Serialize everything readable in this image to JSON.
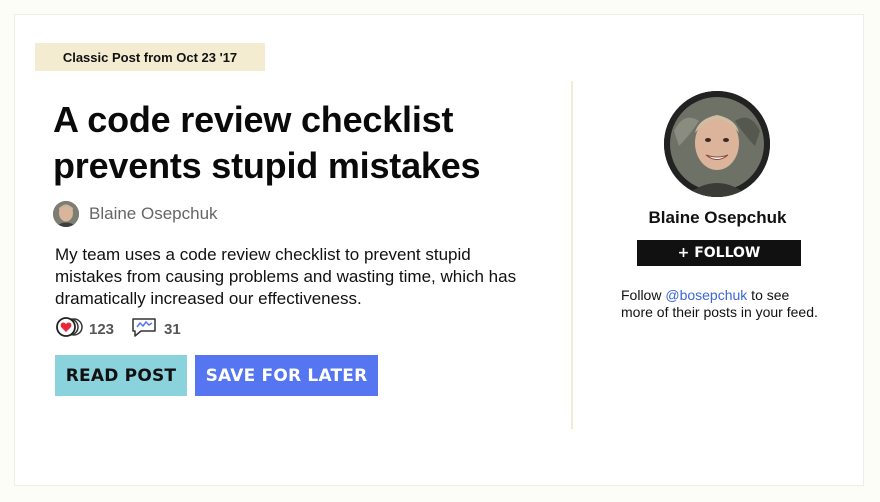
{
  "post": {
    "badge": "Classic Post from Oct 23 '17",
    "title": "A code review checklist prevents stupid mistakes",
    "author": "Blaine Osepchuk",
    "description": "My team uses a code review checklist to prevent stupid mistakes from causing problems and wasting time, which has dramatically increased our effectiveness.",
    "reactions": "123",
    "comments": "31"
  },
  "actions": {
    "read_label": "READ POST",
    "save_label": "SAVE FOR LATER"
  },
  "sidebar": {
    "name": "Blaine Osepchuk",
    "follow_label": "+ FOLLOW",
    "follow_prefix": "Follow ",
    "handle": "@bosepchuk",
    "follow_suffix": " to see more of their posts in your feed."
  },
  "colors": {
    "badge_bg": "#f3ecd0",
    "read_button": "#8ad3dc",
    "save_button": "#5576f0",
    "follow_button": "#111111",
    "link": "#3a66d9"
  },
  "icons": {
    "reactions": "heart-icon",
    "comments": "comment-icon"
  }
}
